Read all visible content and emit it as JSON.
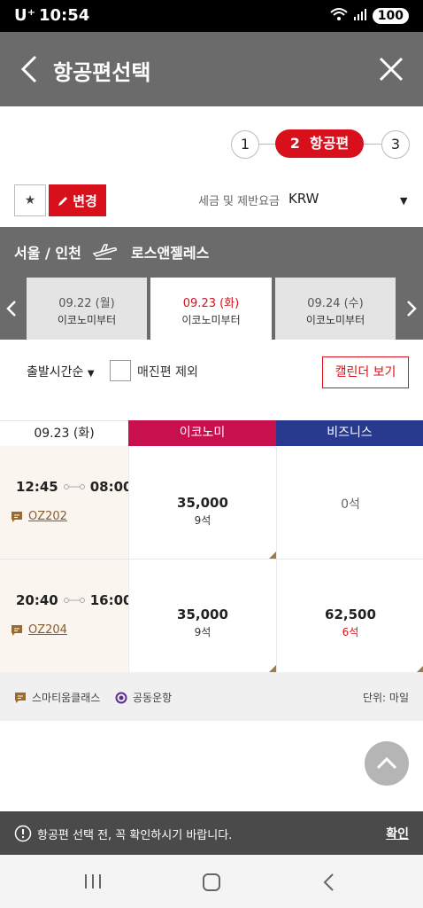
{
  "status_bar": {
    "carrier": "U⁺",
    "time": "10:54",
    "battery": "100"
  },
  "header": {
    "title": "항공편선택"
  },
  "steps": {
    "step1": "1",
    "step2_number": "2",
    "step2_label": "항공편",
    "step3": "3"
  },
  "toolbar": {
    "change_label": "변경",
    "tax_label": "세금 및 제반요금",
    "currency": "KRW"
  },
  "route": {
    "origin": "서울 / 인천",
    "destination": "로스앤젤레스"
  },
  "date_tabs": [
    {
      "date": "09.22 (월)",
      "class": "이코노미부터"
    },
    {
      "date": "09.23 (화)",
      "class": "이코노미부터"
    },
    {
      "date": "09.24 (수)",
      "class": "이코노미부터"
    }
  ],
  "filters": {
    "sort": "출발시간순",
    "exclude_soldout": "매진편 제외",
    "calendar_button": "캘린더 보기"
  },
  "table": {
    "date_header": "09.23 (화)",
    "economy_header": "이코노미",
    "business_header": "비즈니스",
    "rows": [
      {
        "depart": "12:45",
        "arrive": "08:00",
        "flight": "OZ202",
        "economy_price": "35,000",
        "economy_seats": "9석",
        "business_price": "",
        "business_seats": "0석"
      },
      {
        "depart": "20:40",
        "arrive": "16:00",
        "flight": "OZ204",
        "economy_price": "35,000",
        "economy_seats": "9석",
        "business_price": "62,500",
        "business_seats": "6석"
      }
    ]
  },
  "legend": {
    "smartium": "스마티움클래스",
    "codeshare": "공동운항",
    "unit": "단위: 마일"
  },
  "notice": {
    "text": "항공편 선택 전, 꼭 확인하시기 바랍니다.",
    "confirm": "확인"
  },
  "colors": {
    "brand_red": "#d8101c",
    "economy": "#c8104f",
    "business": "#283a8e",
    "header_gray": "#6b6b6b"
  }
}
